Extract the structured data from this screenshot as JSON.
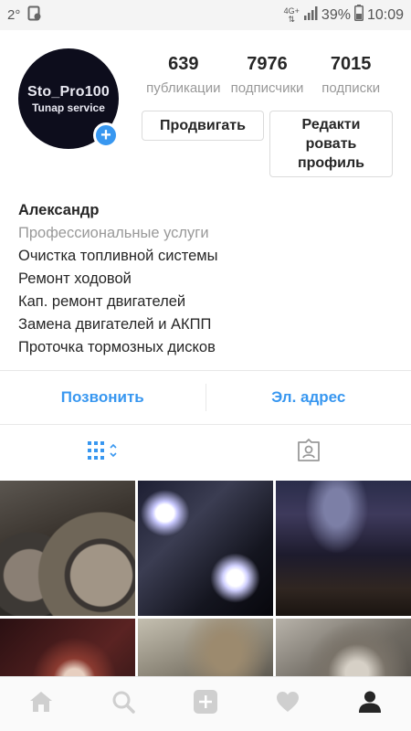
{
  "statusbar": {
    "temperature": "2°",
    "network_type": "4G+",
    "battery_percent": "39%",
    "time": "10:09"
  },
  "profile": {
    "avatar_text_line1": "Sto_Pro100",
    "avatar_text_line2": "Tunap service",
    "add_story_glyph": "+"
  },
  "stats": {
    "posts": {
      "count": "639",
      "label": "публикации"
    },
    "followers": {
      "count": "7976",
      "label": "подписчики"
    },
    "following": {
      "count": "7015",
      "label": "подписки"
    }
  },
  "buttons": {
    "promote": "Продвигать",
    "edit_profile": "Редакти ровать профиль"
  },
  "bio": {
    "name": "Александр",
    "category": "Профессиональные услуги",
    "lines": [
      "Очистка топливной системы",
      "Ремонт ходовой",
      "Кап. ремонт двигателей",
      "Замена двигателей и АКПП",
      "Проточка тормозных дисков"
    ]
  },
  "contact": {
    "call": "Позвонить",
    "email": "Эл. адрес"
  },
  "tabs": {
    "grid_icon": "grid-icon",
    "tagged_icon": "tagged-icon"
  },
  "colors": {
    "accent": "#3897f0",
    "muted_text": "#999999",
    "border": "#dbdbdb"
  },
  "posts_grid": {
    "count_visible": 6
  }
}
